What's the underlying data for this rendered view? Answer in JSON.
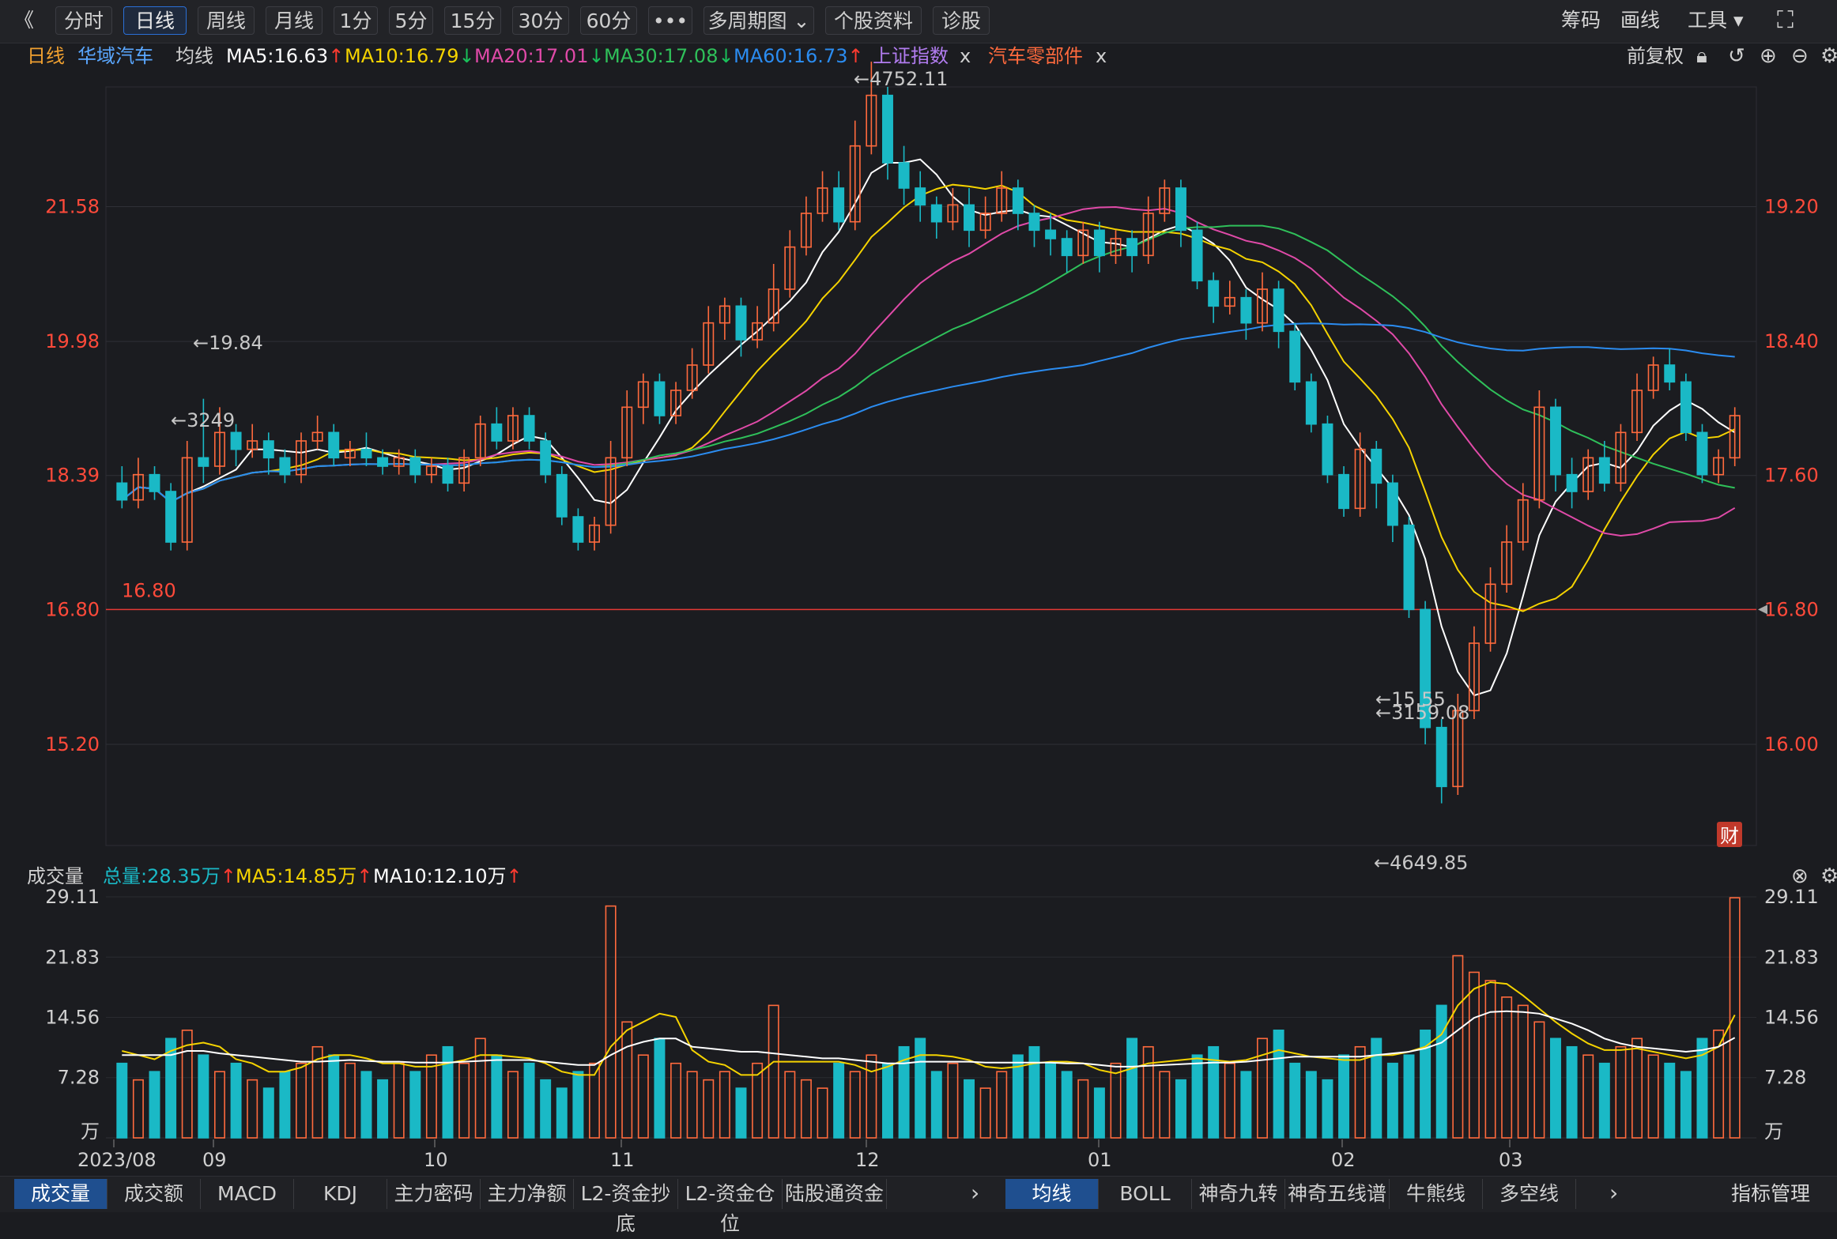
{
  "toolbar": {
    "back": "《",
    "tabs": [
      "分时",
      "日线",
      "周线",
      "月线",
      "1分",
      "5分",
      "15分",
      "30分",
      "60分",
      "•••",
      "多周期图 ⌄",
      "个股资料",
      "诊股"
    ],
    "active": "日线",
    "right": [
      "筹码",
      "画线",
      "工具 ▾"
    ],
    "fullscreen": "⛶"
  },
  "info": {
    "period": "日线",
    "stock": "华域汽车",
    "avg_label": "均线",
    "ma5": "MA5:16.63",
    "ma10": "MA10:16.79",
    "ma20": "MA20:17.01",
    "ma30": "MA30:17.08",
    "ma60": "MA60:16.73",
    "overlay1": "上证指数",
    "overlay2": "汽车零部件",
    "close_x": "x",
    "adjust": "前复权"
  },
  "colors": {
    "up": "#ff6a3d",
    "down": "#1ab9c6",
    "index": "#b27cf0",
    "ma5": "#ffffff",
    "ma10": "#f5d300",
    "ma20": "#e04aa8",
    "ma30": "#2fc05a",
    "ma60": "#2b8cf0",
    "hline": "#e53935"
  },
  "price_axis": {
    "left_ticks": [
      "21.58",
      "19.98",
      "18.39",
      "16.80",
      "15.20"
    ],
    "right_ticks": [
      "19.20",
      "18.40",
      "17.60",
      "16.80",
      "16.00"
    ],
    "hline_label": "16.80",
    "annotations": [
      "←19.84",
      "←4752.11",
      "←4649.85",
      "←3159.08",
      "←15.55",
      "←3249"
    ],
    "fin_badge": "财"
  },
  "volume": {
    "title": "成交量",
    "total": "总量:28.35万",
    "ma5": "MA5:14.85万",
    "ma10": "MA10:12.10万",
    "ticks": [
      "29.11",
      "21.83",
      "14.56",
      "7.28",
      "万"
    ]
  },
  "x_axis": [
    "2023/08",
    "09",
    "10",
    "11",
    "12",
    "01",
    "02",
    "03"
  ],
  "bottom_tabs_left": [
    "成交量",
    "成交额",
    "MACD",
    "KDJ",
    "主力密码",
    "主力净额",
    "L2-资金抄底",
    "L2-资金仓位",
    "陆股通资金"
  ],
  "bottom_tabs_right": [
    "均线",
    "BOLL",
    "神奇九转",
    "神奇五线谱",
    "牛熊线",
    "多空线"
  ],
  "indicator_manage": "指标管理",
  "chart_data": {
    "type": "candlestick",
    "y_range_left": [
      14.0,
      23.0
    ],
    "y_range_right": [
      15.6,
      20.0
    ],
    "candles": [
      [
        18.3,
        18.1,
        18.5,
        18.0
      ],
      [
        18.1,
        18.4,
        18.6,
        18.0
      ],
      [
        18.4,
        18.2,
        18.5,
        18.1
      ],
      [
        18.2,
        17.6,
        18.3,
        17.5
      ],
      [
        17.6,
        18.6,
        18.8,
        17.5
      ],
      [
        18.6,
        18.5,
        19.3,
        18.3
      ],
      [
        18.5,
        18.9,
        19.2,
        18.4
      ],
      [
        18.9,
        18.7,
        19.0,
        18.5
      ],
      [
        18.7,
        18.8,
        19.0,
        18.6
      ],
      [
        18.8,
        18.6,
        18.9,
        18.4
      ],
      [
        18.6,
        18.4,
        18.7,
        18.3
      ],
      [
        18.4,
        18.8,
        18.9,
        18.3
      ],
      [
        18.8,
        18.9,
        19.1,
        18.7
      ],
      [
        18.9,
        18.6,
        19.0,
        18.5
      ],
      [
        18.6,
        18.7,
        18.8,
        18.5
      ],
      [
        18.7,
        18.6,
        18.9,
        18.5
      ],
      [
        18.6,
        18.5,
        18.7,
        18.4
      ],
      [
        18.5,
        18.6,
        18.7,
        18.4
      ],
      [
        18.6,
        18.4,
        18.7,
        18.3
      ],
      [
        18.4,
        18.5,
        18.6,
        18.3
      ],
      [
        18.5,
        18.3,
        18.6,
        18.2
      ],
      [
        18.3,
        18.6,
        18.7,
        18.2
      ],
      [
        18.6,
        19.0,
        19.1,
        18.5
      ],
      [
        19.0,
        18.8,
        19.2,
        18.7
      ],
      [
        18.8,
        19.1,
        19.2,
        18.7
      ],
      [
        19.1,
        18.8,
        19.2,
        18.7
      ],
      [
        18.8,
        18.4,
        18.9,
        18.3
      ],
      [
        18.4,
        17.9,
        18.5,
        17.8
      ],
      [
        17.9,
        17.6,
        18.0,
        17.5
      ],
      [
        17.6,
        17.8,
        17.9,
        17.5
      ],
      [
        17.8,
        18.6,
        18.8,
        17.7
      ],
      [
        18.6,
        19.2,
        19.4,
        18.5
      ],
      [
        19.2,
        19.5,
        19.6,
        19.0
      ],
      [
        19.5,
        19.1,
        19.6,
        19.0
      ],
      [
        19.1,
        19.4,
        19.5,
        19.0
      ],
      [
        19.4,
        19.7,
        19.9,
        19.3
      ],
      [
        19.7,
        20.2,
        20.4,
        19.6
      ],
      [
        20.2,
        20.4,
        20.5,
        20.0
      ],
      [
        20.4,
        20.0,
        20.5,
        19.8
      ],
      [
        20.0,
        20.2,
        20.4,
        19.9
      ],
      [
        20.2,
        20.6,
        20.9,
        20.1
      ],
      [
        20.6,
        21.1,
        21.3,
        20.5
      ],
      [
        21.1,
        21.5,
        21.7,
        21.0
      ],
      [
        21.5,
        21.8,
        22.0,
        21.4
      ],
      [
        21.8,
        21.4,
        22.0,
        21.3
      ],
      [
        21.4,
        22.3,
        22.6,
        21.3
      ],
      [
        22.3,
        22.9,
        23.3,
        22.2
      ],
      [
        22.9,
        22.1,
        23.0,
        21.9
      ],
      [
        22.1,
        21.8,
        22.3,
        21.6
      ],
      [
        21.8,
        21.6,
        22.0,
        21.4
      ],
      [
        21.6,
        21.4,
        21.7,
        21.2
      ],
      [
        21.4,
        21.6,
        21.8,
        21.3
      ],
      [
        21.6,
        21.3,
        21.8,
        21.1
      ],
      [
        21.3,
        21.5,
        21.7,
        21.2
      ],
      [
        21.5,
        21.8,
        22.0,
        21.4
      ],
      [
        21.8,
        21.5,
        21.9,
        21.3
      ],
      [
        21.5,
        21.3,
        21.6,
        21.1
      ],
      [
        21.3,
        21.2,
        21.5,
        21.0
      ],
      [
        21.2,
        21.0,
        21.3,
        20.8
      ],
      [
        21.0,
        21.3,
        21.4,
        20.9
      ],
      [
        21.3,
        21.0,
        21.4,
        20.8
      ],
      [
        21.0,
        21.2,
        21.3,
        20.9
      ],
      [
        21.2,
        21.0,
        21.3,
        20.8
      ],
      [
        21.0,
        21.5,
        21.7,
        20.9
      ],
      [
        21.5,
        21.8,
        21.9,
        21.4
      ],
      [
        21.8,
        21.3,
        21.9,
        21.1
      ],
      [
        21.3,
        20.7,
        21.4,
        20.6
      ],
      [
        20.7,
        20.4,
        20.8,
        20.2
      ],
      [
        20.4,
        20.5,
        20.7,
        20.3
      ],
      [
        20.5,
        20.2,
        20.6,
        20.0
      ],
      [
        20.2,
        20.6,
        20.8,
        20.1
      ],
      [
        20.6,
        20.1,
        20.7,
        19.9
      ],
      [
        20.1,
        19.5,
        20.2,
        19.4
      ],
      [
        19.5,
        19.0,
        19.6,
        18.9
      ],
      [
        19.0,
        18.4,
        19.1,
        18.3
      ],
      [
        18.4,
        18.0,
        18.5,
        17.9
      ],
      [
        18.0,
        18.7,
        18.9,
        17.9
      ],
      [
        18.7,
        18.3,
        18.8,
        18.0
      ],
      [
        18.3,
        17.8,
        18.4,
        17.6
      ],
      [
        17.8,
        16.8,
        17.9,
        16.7
      ],
      [
        16.8,
        15.4,
        16.9,
        15.2
      ],
      [
        15.4,
        14.7,
        15.5,
        14.5
      ],
      [
        14.7,
        15.6,
        15.8,
        14.6
      ],
      [
        15.6,
        16.4,
        16.6,
        15.5
      ],
      [
        16.4,
        17.1,
        17.3,
        16.3
      ],
      [
        17.1,
        17.6,
        17.8,
        17.0
      ],
      [
        17.6,
        18.1,
        18.3,
        17.5
      ],
      [
        18.1,
        19.2,
        19.4,
        18.0
      ],
      [
        19.2,
        18.4,
        19.3,
        18.2
      ],
      [
        18.4,
        18.2,
        18.6,
        18.0
      ],
      [
        18.2,
        18.6,
        18.7,
        18.1
      ],
      [
        18.6,
        18.3,
        18.8,
        18.2
      ],
      [
        18.3,
        18.9,
        19.0,
        18.2
      ],
      [
        18.9,
        19.4,
        19.6,
        18.8
      ],
      [
        19.4,
        19.7,
        19.8,
        19.3
      ],
      [
        19.7,
        19.5,
        19.9,
        19.4
      ],
      [
        19.5,
        18.9,
        19.6,
        18.8
      ],
      [
        18.9,
        18.4,
        19.0,
        18.3
      ],
      [
        18.4,
        18.6,
        18.7,
        18.3
      ],
      [
        18.6,
        19.1,
        19.2,
        18.5
      ]
    ],
    "volumes": [
      9,
      7,
      8,
      12,
      13,
      10,
      8,
      9,
      7,
      6,
      8,
      9,
      11,
      10,
      9,
      8,
      7,
      9,
      8,
      10,
      11,
      9,
      12,
      10,
      8,
      9,
      7,
      6,
      8,
      9,
      28,
      14,
      10,
      12,
      9,
      8,
      7,
      8,
      6,
      9,
      16,
      8,
      7,
      6,
      9,
      8,
      10,
      9,
      11,
      12,
      8,
      9,
      7,
      6,
      8,
      10,
      11,
      9,
      8,
      7,
      6,
      9,
      12,
      11,
      8,
      7,
      10,
      11,
      9,
      8,
      12,
      13,
      9,
      8,
      7,
      10,
      11,
      12,
      9,
      10,
      13,
      16,
      22,
      20,
      19,
      17,
      16,
      14,
      12,
      11,
      10,
      9,
      11,
      12,
      10,
      9,
      8,
      12,
      13,
      29
    ],
    "volume_ma5": [
      10.5,
      10,
      9.5,
      10.5,
      11.2,
      11.5,
      11,
      9.5,
      9,
      8,
      8,
      8.5,
      9.5,
      10,
      10,
      9.6,
      9,
      9,
      8.6,
      8.6,
      9,
      9.4,
      10,
      10,
      9.8,
      9.6,
      9,
      8,
      7.6,
      7.6,
      11,
      13,
      14,
      15,
      14.6,
      10.6,
      9.2,
      8.8,
      7.6,
      7.6,
      9.2,
      9.2,
      9.2,
      9.2,
      9.2,
      8.8,
      8,
      8.6,
      9.4,
      10,
      10,
      9.8,
      9.4,
      8.6,
      8.4,
      8.6,
      9,
      9.2,
      9.2,
      9,
      8.2,
      7.8,
      8.4,
      9,
      9.2,
      9.4,
      9.6,
      9.4,
      9.2,
      9.4,
      10,
      10.6,
      10.2,
      9.8,
      9.6,
      9.4,
      9.4,
      10,
      10,
      10.4,
      11,
      12.5,
      16,
      18,
      18.8,
      18.6,
      17.2,
      15.6,
      14,
      12.6,
      11.4,
      10.6,
      10.6,
      10.8,
      10.4,
      10,
      9.6,
      10,
      11,
      14.85
    ],
    "volume_ma10": [
      10,
      10,
      10,
      10,
      10.5,
      10.5,
      10.2,
      10,
      9.8,
      9.6,
      9.4,
      9.2,
      9.2,
      9.3,
      9.4,
      9.3,
      9.2,
      9.2,
      9.1,
      9.1,
      9.1,
      9.2,
      9.3,
      9.4,
      9.4,
      9.4,
      9.2,
      9,
      8.8,
      8.8,
      10,
      11,
      11.6,
      12,
      12,
      11,
      10.8,
      10.6,
      10.4,
      10.4,
      10.2,
      10,
      9.8,
      9.6,
      9.6,
      9.4,
      9.2,
      9,
      9,
      9.2,
      9.2,
      9.2,
      9.2,
      9.1,
      9.1,
      9.1,
      9.1,
      9.1,
      9,
      9,
      8.8,
      8.6,
      8.6,
      8.7,
      8.8,
      8.9,
      9,
      9.1,
      9.1,
      9.2,
      9.4,
      9.6,
      9.8,
      9.8,
      9.8,
      9.8,
      9.8,
      10,
      10.2,
      10.4,
      10.8,
      11.5,
      13,
      14.5,
      15.2,
      15.3,
      15.2,
      15,
      14.4,
      13.8,
      13,
      12,
      11.4,
      11,
      10.8,
      10.6,
      10.4,
      10.6,
      11,
      12.1
    ]
  }
}
